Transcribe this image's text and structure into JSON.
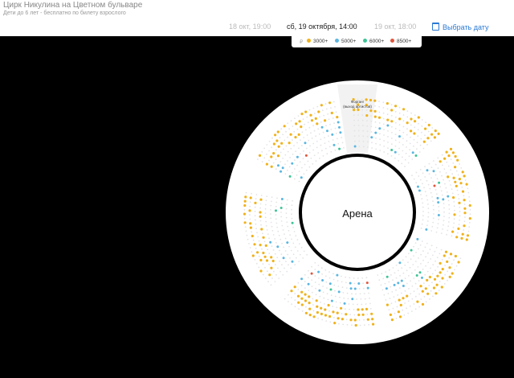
{
  "header": {
    "venue_title": "Цирк Никулина на Цветном бульваре",
    "venue_subtitle": "Дети до 6 лет - бесплатно по билету взрослого"
  },
  "sessions": [
    {
      "label": "18 окт, 19:00",
      "active": false
    },
    {
      "label": "сб, 19 октября, 14:00",
      "active": true
    },
    {
      "label": "19 окт, 18:00",
      "active": false
    }
  ],
  "date_button": {
    "label": "Выбрать дату",
    "icon": "calendar-icon"
  },
  "legend": {
    "currency": "₽",
    "items": [
      {
        "label": "3000+",
        "color": "#f0b21c"
      },
      {
        "label": "5000+",
        "color": "#5bb6e0"
      },
      {
        "label": "6000+",
        "color": "#3ec496"
      },
      {
        "label": "8500+",
        "color": "#e2563d"
      }
    ]
  },
  "hall": {
    "arena_label": "Арена",
    "forgang_label_line1": "Форганг",
    "forgang_label_line2": "(выход артистов)",
    "colors": {
      "available_3000": "#f0b21c",
      "available_5000": "#5bb6e0",
      "available_6000": "#3ec496",
      "available_8500": "#e2563d",
      "unavailable": "#e3e3e3"
    }
  }
}
